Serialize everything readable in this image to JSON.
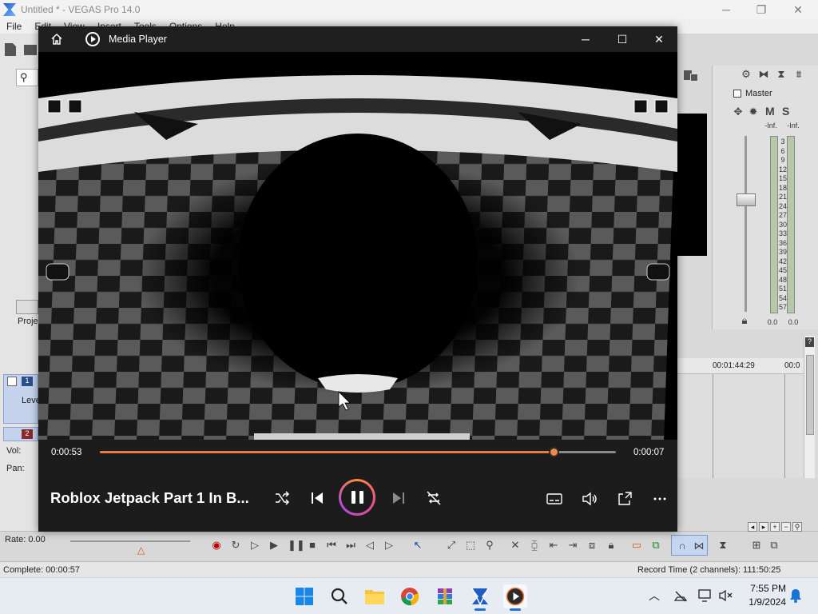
{
  "vegas": {
    "title": "Untitled * - VEGAS Pro 14.0",
    "menu": [
      "File",
      "Edit",
      "View",
      "Insert",
      "Tools",
      "Options",
      "Help"
    ],
    "mixer": {
      "master_label": "Master",
      "m_label": "M",
      "s_label": "S",
      "peak_left": "-Inf.",
      "peak_right": "-Inf.",
      "scale": [
        "3",
        "6",
        "9",
        "12",
        "15",
        "18",
        "21",
        "24",
        "27",
        "30",
        "33",
        "36",
        "39",
        "42",
        "45",
        "48",
        "51",
        "54",
        "57"
      ],
      "value_left": "0.0",
      "value_right": "0.0"
    },
    "timeline": {
      "ruler_time_1": "00:01:44:29",
      "ruler_time_2": "00:0"
    },
    "tracks": {
      "track1_num": "1",
      "track1_label": "Leve",
      "track2_num": "2",
      "vol_label": "Vol:",
      "pan_label": "Pan:"
    },
    "project_tab": "Proje",
    "rate_label": "Rate: 0.00",
    "status_complete": "Complete: 00:00:57",
    "record_time": "Record Time (2 channels): 111:50:25"
  },
  "player": {
    "app_name": "Media Player",
    "time_elapsed": "0:00:53",
    "time_remaining": "0:00:07",
    "progress_fraction": 0.88,
    "song_title": "Roblox Jetpack Part 1 In B...",
    "accent_color": "#e97b3c"
  },
  "taskbar": {
    "time": "7:55 PM",
    "date": "1/9/2024"
  }
}
